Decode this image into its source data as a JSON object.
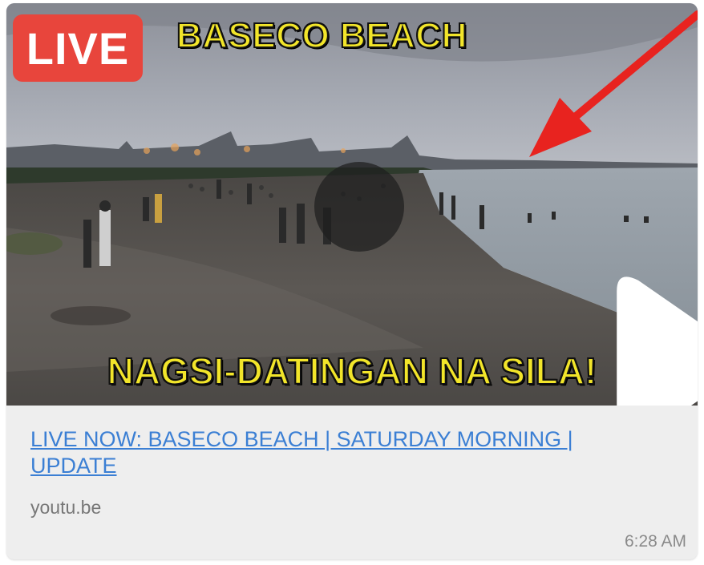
{
  "thumbnail": {
    "live_badge": "LIVE",
    "top_caption": "BASECO BEACH",
    "bottom_caption": "NAGSI-DATINGAN NA SILA!",
    "play_icon": "play-icon",
    "arrow_icon": "arrow-icon"
  },
  "link": {
    "title": "LIVE NOW: BASECO BEACH | SATURDAY MORNING | UPDATE",
    "domain": "youtu.be"
  },
  "message": {
    "timestamp": "6:28 AM"
  },
  "colors": {
    "live_badge": "#e8453c",
    "caption_yellow": "#f2e52a",
    "link_blue": "#3b7fd4",
    "bubble_bg": "#eeeeee",
    "arrow_red": "#e8231f"
  }
}
